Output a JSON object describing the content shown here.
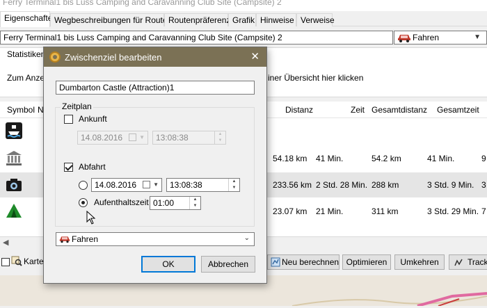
{
  "window": {
    "title": "Ferry Terminal1 bis Luss Camping and Caravanning Club Site (Campsite) 2"
  },
  "tabs": [
    "Eigenschaften",
    "Wegbeschreibungen für Routen",
    "Routenpräferenz",
    "Grafik",
    "Hinweise",
    "Verweise"
  ],
  "route": {
    "name": "Ferry Terminal1 bis Luss Camping and Caravanning Club Site (Campsite) 2",
    "mode": "Fahren"
  },
  "stats": {
    "label": "Statistiken",
    "text_left": "Zum Anzeig",
    "text_right": "iner Übersicht hier klicken"
  },
  "table": {
    "headers": {
      "symbol": "Symbol",
      "name": "N",
      "distanz": "Distanz",
      "zeit": "Zeit",
      "gesamtdistanz": "Gesamtdistanz",
      "gesamtzeit": "Gesamtzeit"
    },
    "rows": [
      {
        "icon": "ferry-icon",
        "distanz": "",
        "zeit": "",
        "gesamtdistanz": "",
        "gesamtzeit": "",
        "extra": ""
      },
      {
        "icon": "museum-icon",
        "distanz": "54.18 km",
        "zeit": "41 Min.",
        "gesamtdistanz": "54.2 km",
        "gesamtzeit": "41 Min.",
        "extra": "9"
      },
      {
        "icon": "camera-icon",
        "distanz": "233.56 km",
        "zeit": "2 Std. 28 Min.",
        "gesamtdistanz": "288 km",
        "gesamtzeit": "3 Std. 9 Min.",
        "extra": "3"
      },
      {
        "icon": "campsite-icon",
        "distanz": "23.07 km",
        "zeit": "21 Min.",
        "gesamtdistanz": "311 km",
        "gesamtzeit": "3 Std. 29 Min.",
        "extra": "7"
      }
    ]
  },
  "bottom": {
    "karte_label": "Karte",
    "recalc_label": "Neu berechnen",
    "optimize_label": "Optimieren",
    "reverse_label": "Umkehren",
    "track_label": "Track"
  },
  "dialog": {
    "title": "Zwischenziel bearbeiten",
    "name": "Dumbarton Castle (Attraction)1",
    "zeitplan_label": "Zeitplan",
    "ankunft": {
      "label": "Ankunft",
      "checked": false,
      "date": "14.08.2016",
      "time": "13:08:38"
    },
    "abfahrt": {
      "label": "Abfahrt",
      "checked": true,
      "date": "14.08.2016",
      "time": "13:08:38"
    },
    "aufenthalt": {
      "label": "Aufenthaltszeit",
      "value": "01:00"
    },
    "mode": "Fahren",
    "ok_label": "OK",
    "cancel_label": "Abbrechen"
  },
  "colors": {
    "dialog_title_bg": "#7b7155",
    "accent": "#0078d7",
    "car_red": "#c0392b"
  }
}
